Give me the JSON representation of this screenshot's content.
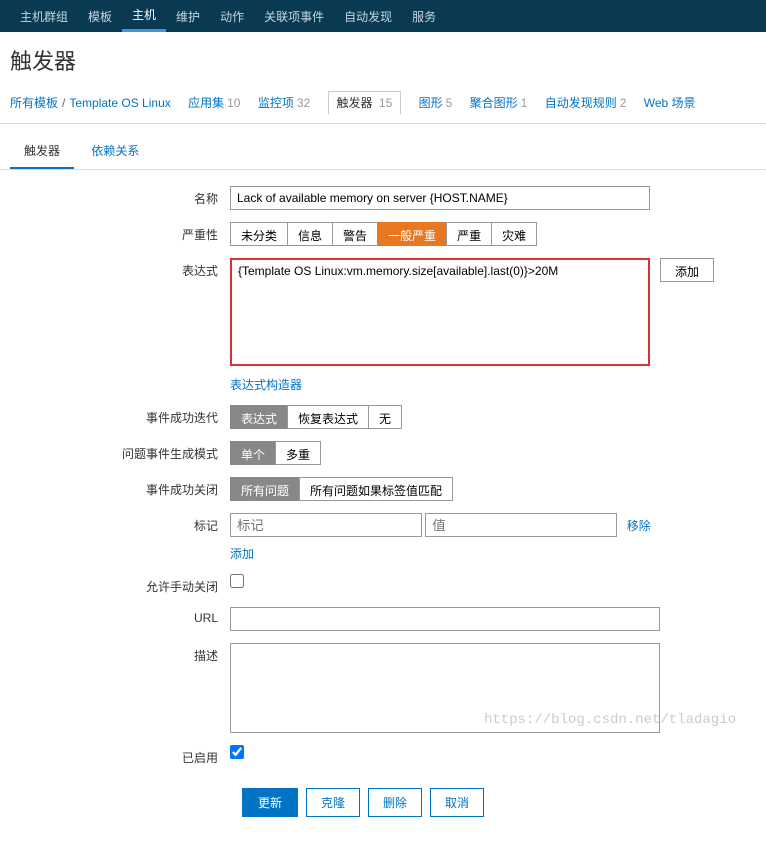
{
  "topnav": {
    "items": [
      "主机群组",
      "模板",
      "主机",
      "维护",
      "动作",
      "关联项事件",
      "自动发现",
      "服务"
    ],
    "activeIndex": 2
  },
  "pageTitle": "触发器",
  "breadcrumb": {
    "allTemplates": "所有模板",
    "template": "Template OS Linux",
    "tabs": [
      {
        "label": "应用集",
        "count": "10"
      },
      {
        "label": "监控项",
        "count": "32"
      },
      {
        "label": "触发器",
        "count": "15",
        "active": true
      },
      {
        "label": "图形",
        "count": "5"
      },
      {
        "label": "聚合图形",
        "count": "1"
      },
      {
        "label": "自动发现规则",
        "count": "2"
      },
      {
        "label": "Web 场景",
        "count": ""
      }
    ]
  },
  "subTabs": [
    "触发器",
    "依赖关系"
  ],
  "labels": {
    "name": "名称",
    "severity": "严重性",
    "expression": "表达式",
    "exprBuilder": "表达式构造器",
    "okEventGen": "事件成功迭代",
    "problemEventGen": "问题事件生成模式",
    "okEventCloses": "事件成功关闭",
    "tags": "标记",
    "allowManualClose": "允许手动关闭",
    "url": "URL",
    "description": "描述",
    "enabled": "已启用"
  },
  "values": {
    "name": "Lack of available memory on server {HOST.NAME}",
    "expression": "{Template OS Linux:vm.memory.size[available].last(0)}>20M",
    "enabled": true
  },
  "severity": {
    "options": [
      "未分类",
      "信息",
      "警告",
      "一般严重",
      "严重",
      "灾难"
    ],
    "selected": "一般严重"
  },
  "okEventGen": {
    "options": [
      "表达式",
      "恢复表达式",
      "无"
    ],
    "selected": "表达式"
  },
  "problemEventGen": {
    "options": [
      "单个",
      "多重"
    ],
    "selected": "单个"
  },
  "okEventCloses": {
    "options": [
      "所有问题",
      "所有问题如果标签值匹配"
    ],
    "selected": "所有问题"
  },
  "tagRow": {
    "namePlaceholder": "标记",
    "valuePlaceholder": "值",
    "remove": "移除",
    "add": "添加"
  },
  "buttons": {
    "add": "添加",
    "update": "更新",
    "clone": "克隆",
    "delete": "删除",
    "cancel": "取消"
  },
  "watermark": "https://blog.csdn.net/tladagio"
}
